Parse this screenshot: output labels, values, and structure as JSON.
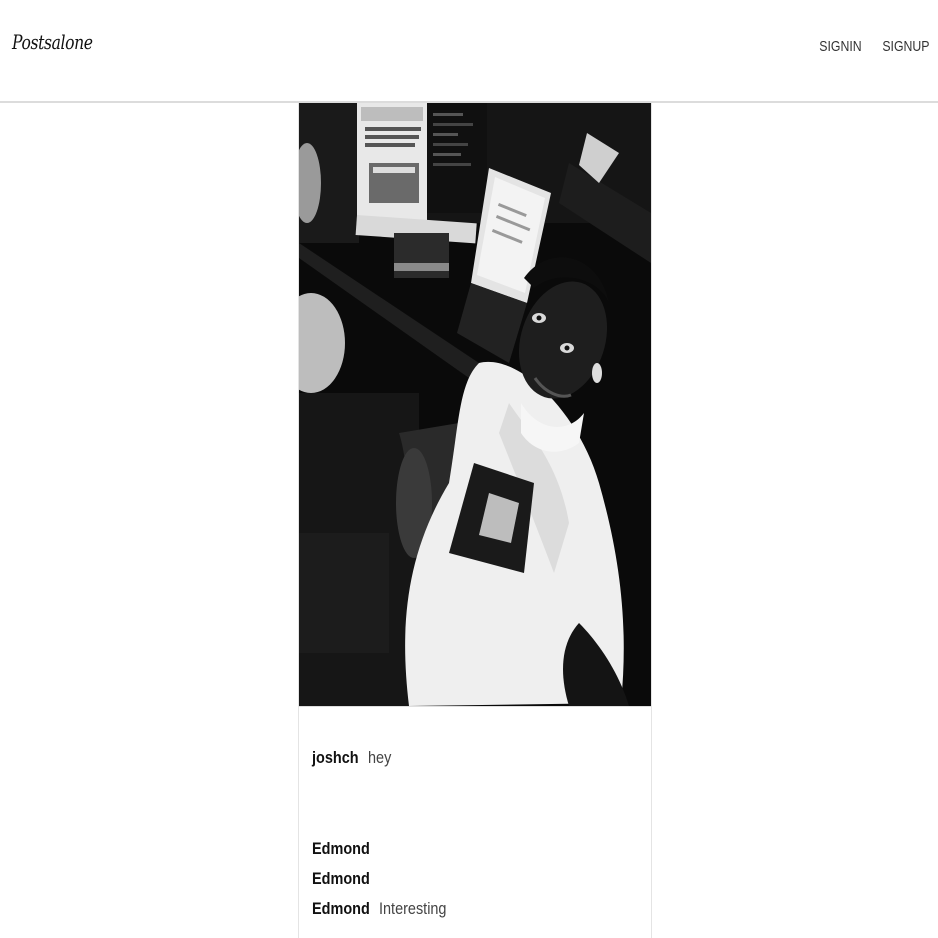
{
  "header": {
    "logo": "Postsalone",
    "nav": {
      "signin": "SIGNIN",
      "signup": "SIGNUP"
    }
  },
  "post": {
    "image_description_icon": "photo",
    "author": "joshch",
    "caption": "hey",
    "comments": [
      {
        "user": "Edmond",
        "text": ""
      },
      {
        "user": "Edmond",
        "text": ""
      },
      {
        "user": "Edmond",
        "text": "Interesting"
      }
    ]
  },
  "colors": {
    "background": "#ffffff",
    "header_border": "#dcdcdc",
    "text": "#111111"
  }
}
